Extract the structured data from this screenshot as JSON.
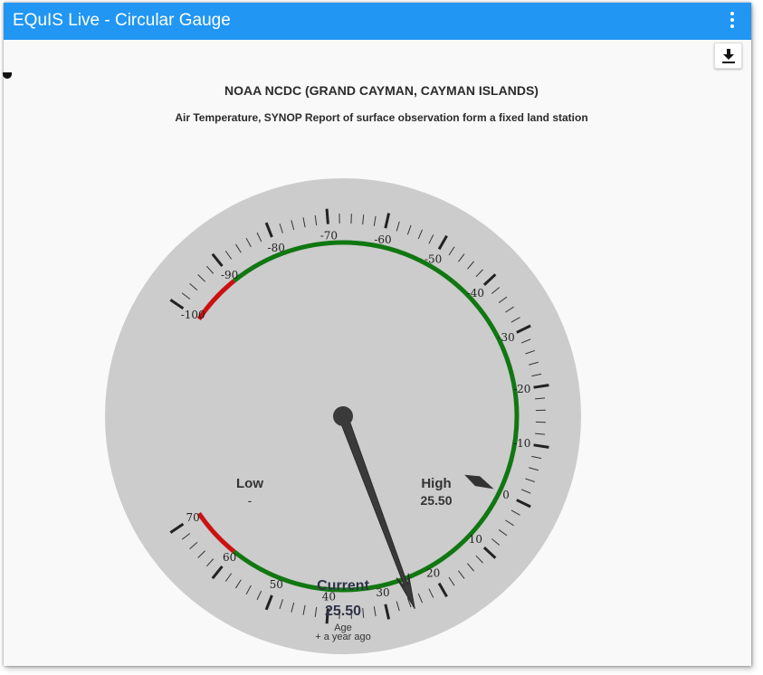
{
  "window": {
    "title": "EQuIS Live - Circular Gauge",
    "menu_icon": "more-vertical-icon",
    "download_icon": "download-icon",
    "accent_color": "#2196f3"
  },
  "gauge": {
    "title": "NOAA NCDC (GRAND CAYMAN, CAYMAN ISLANDS)",
    "subtitle": "Air Temperature, SYNOP Report of surface observation form a fixed land station",
    "scale_min": -100,
    "scale_max": 70,
    "major_tick_labels": [
      "-100",
      "-90",
      "-80",
      "-70",
      "-60",
      "-50",
      "-40",
      "-30",
      "-20",
      "-10",
      "0",
      "10",
      "20",
      "30",
      "40",
      "50",
      "60",
      "70"
    ],
    "minor_tick_step": 2,
    "bands": [
      {
        "from": -100,
        "to": -90,
        "color": "#cc1111"
      },
      {
        "from": -90,
        "to": 60,
        "color": "#117711"
      },
      {
        "from": 60,
        "to": 70,
        "color": "#cc1111"
      }
    ],
    "needle_value": 25.5,
    "marker_value": 0,
    "low": {
      "label": "Low",
      "value": "-"
    },
    "high": {
      "label": "High",
      "value": "25.50"
    },
    "current": {
      "label": "Current",
      "value": "25.50"
    },
    "age": {
      "label": "Age",
      "value": "+ a year ago"
    }
  }
}
